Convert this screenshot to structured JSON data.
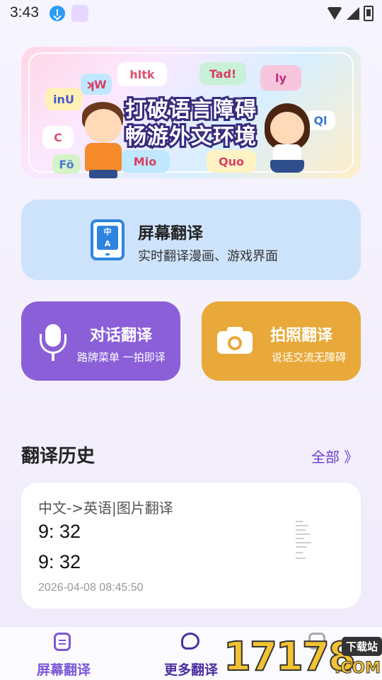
{
  "status_bar": {
    "time": "3:43",
    "icons": [
      "download-icon",
      "app-notification-icon",
      "wifi-icon",
      "signal-icon",
      "battery-icon"
    ]
  },
  "banner": {
    "line1": "打破语言障碍",
    "line2": "畅游外文环境",
    "bubbles": [
      "hltk",
      "Tad!",
      "ly",
      "inU",
      "C",
      "ʞW",
      "Ql",
      "Mio",
      "Quo",
      "Fö"
    ]
  },
  "screen_translate": {
    "title": "屏幕翻译",
    "subtitle": "实时翻译漫画、游戏界面",
    "icon": "screen-translate-icon"
  },
  "dialog_translate": {
    "title": "对话翻译",
    "subtitle": "路牌菜单 一拍即译",
    "icon": "microphone-icon"
  },
  "photo_translate": {
    "title": "拍照翻译",
    "subtitle": "说话交流无障碍",
    "icon": "camera-icon"
  },
  "history": {
    "title": "翻译历史",
    "view_all": "全部 》",
    "items": [
      {
        "meta": "中文->英语|图片翻译",
        "source": "9: 32",
        "target": "9: 32",
        "time": "2026-04-08 08:45:50"
      }
    ]
  },
  "tabbar": {
    "tabs": [
      {
        "label": "屏幕翻译",
        "icon": "document-icon"
      },
      {
        "label": "更多翻译",
        "icon": "chat-icon"
      },
      {
        "label": "",
        "icon": "settings-icon"
      }
    ]
  },
  "watermark": {
    "digits": "17178",
    "tag": "下载站",
    "suffix": ".COM"
  },
  "colors": {
    "accent": "#8a5fd8",
    "screen_card": "#cde3fb",
    "photo_card": "#e8a93a",
    "link": "#6a3fd0"
  }
}
